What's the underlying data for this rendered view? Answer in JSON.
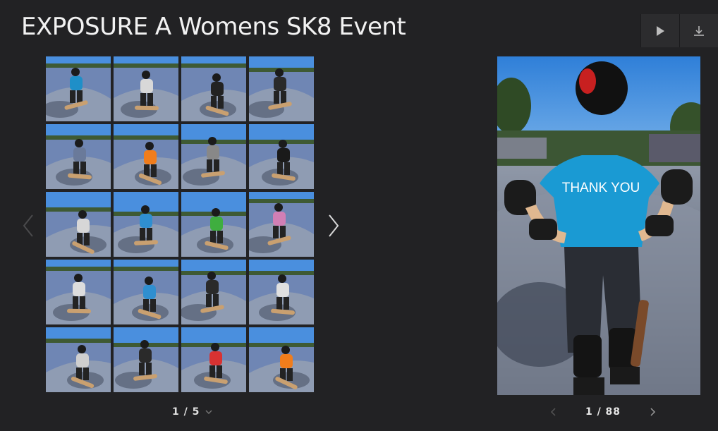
{
  "gallery": {
    "title": "EXPOSURE A Womens SK8 Event"
  },
  "toolbar": {
    "play_icon": "play-icon",
    "download_icon": "download-icon"
  },
  "thumbnail_grid": {
    "page_indicator": "1 / 5",
    "thumbnails": [
      {
        "subject": "skater back with THANK YOU shirt",
        "shirt": "#1f8fc8"
      },
      {
        "subject": "skater in bowl",
        "shirt": "#d8d8d8"
      },
      {
        "subject": "skater carving",
        "shirt": "#222222"
      },
      {
        "subject": "skater aerial",
        "shirt": "#2a2a2a"
      },
      {
        "subject": "skater in bowl",
        "shirt": "#6a7a9a"
      },
      {
        "subject": "skater carving",
        "shirt": "#f07d1c"
      },
      {
        "subject": "skater grind",
        "shirt": "#888888"
      },
      {
        "subject": "skater carving",
        "shirt": "#1a1a1a"
      },
      {
        "subject": "skater aerial",
        "shirt": "#d7d7d7"
      },
      {
        "subject": "skater carving",
        "shirt": "#2f8fd0"
      },
      {
        "subject": "skater carving",
        "shirt": "#3fae3f"
      },
      {
        "subject": "skater carving",
        "shirt": "#d17fb5"
      },
      {
        "subject": "skater carving",
        "shirt": "#dddddd"
      },
      {
        "subject": "skater carving",
        "shirt": "#2f8fd0"
      },
      {
        "subject": "skater carving",
        "shirt": "#2a2a2a"
      },
      {
        "subject": "skater in bowl",
        "shirt": "#e0e0e0"
      },
      {
        "subject": "skater in bowl",
        "shirt": "#cfcfcf"
      },
      {
        "subject": "skater on board",
        "shirt": "#2a2a2a"
      },
      {
        "subject": "skater jumping",
        "shirt": "#d83232"
      },
      {
        "subject": "skater carving",
        "shirt": "#f07d1c"
      }
    ]
  },
  "main_photo": {
    "shirt_text": "THANK YOU",
    "counter": "1 / 88"
  },
  "colors": {
    "background": "#222224",
    "sky": "#3c8ee0",
    "bowl": "#6d84b2",
    "shirt_blue": "#1a9ad3"
  }
}
